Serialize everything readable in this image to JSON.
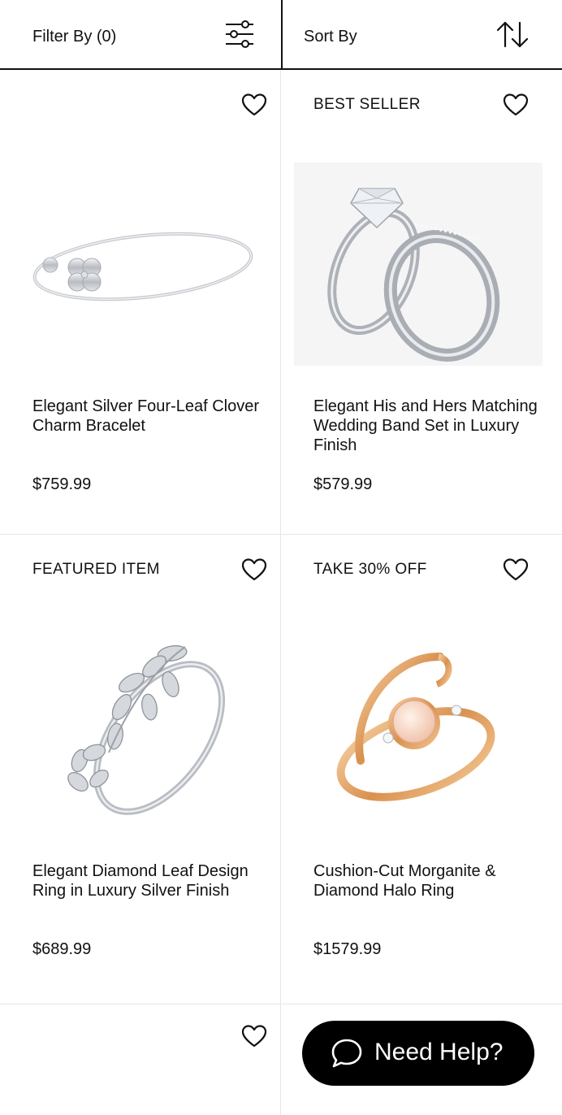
{
  "toolbar": {
    "filter_label": "Filter By (0)",
    "filter_icon": "sliders-icon",
    "sort_label": "Sort By",
    "sort_icon": "sort-arrows-icon"
  },
  "products": [
    {
      "badge": "",
      "title": "Elegant Silver Four-Leaf Clover Charm Bracelet",
      "price": "$759.99",
      "image": "silver-clover-bracelet",
      "favorite_icon": "heart-outline-icon"
    },
    {
      "badge": "BEST SELLER",
      "title": "Elegant His and Hers Matching Wedding Band Set in Luxury Finish",
      "price": "$579.99",
      "image": "wedding-band-set",
      "favorite_icon": "heart-outline-icon"
    },
    {
      "badge": "FEATURED ITEM",
      "title": "Elegant Diamond Leaf Design Ring in Luxury Silver Finish",
      "price": "$689.99",
      "image": "diamond-leaf-ring",
      "favorite_icon": "heart-outline-icon"
    },
    {
      "badge": "TAKE 30% OFF",
      "title": "Cushion-Cut Morganite & Diamond Halo Ring",
      "price": "$1579.99",
      "image": "morganite-ring",
      "favorite_icon": "heart-outline-icon"
    }
  ],
  "help": {
    "label": "Need Help?",
    "icon": "chat-bubble-icon"
  },
  "colors": {
    "text": "#111111",
    "divider": "#e6e6e6",
    "help_bg": "#000000",
    "rose_gold": "#e8a970",
    "silver": "#c9ccd1"
  }
}
